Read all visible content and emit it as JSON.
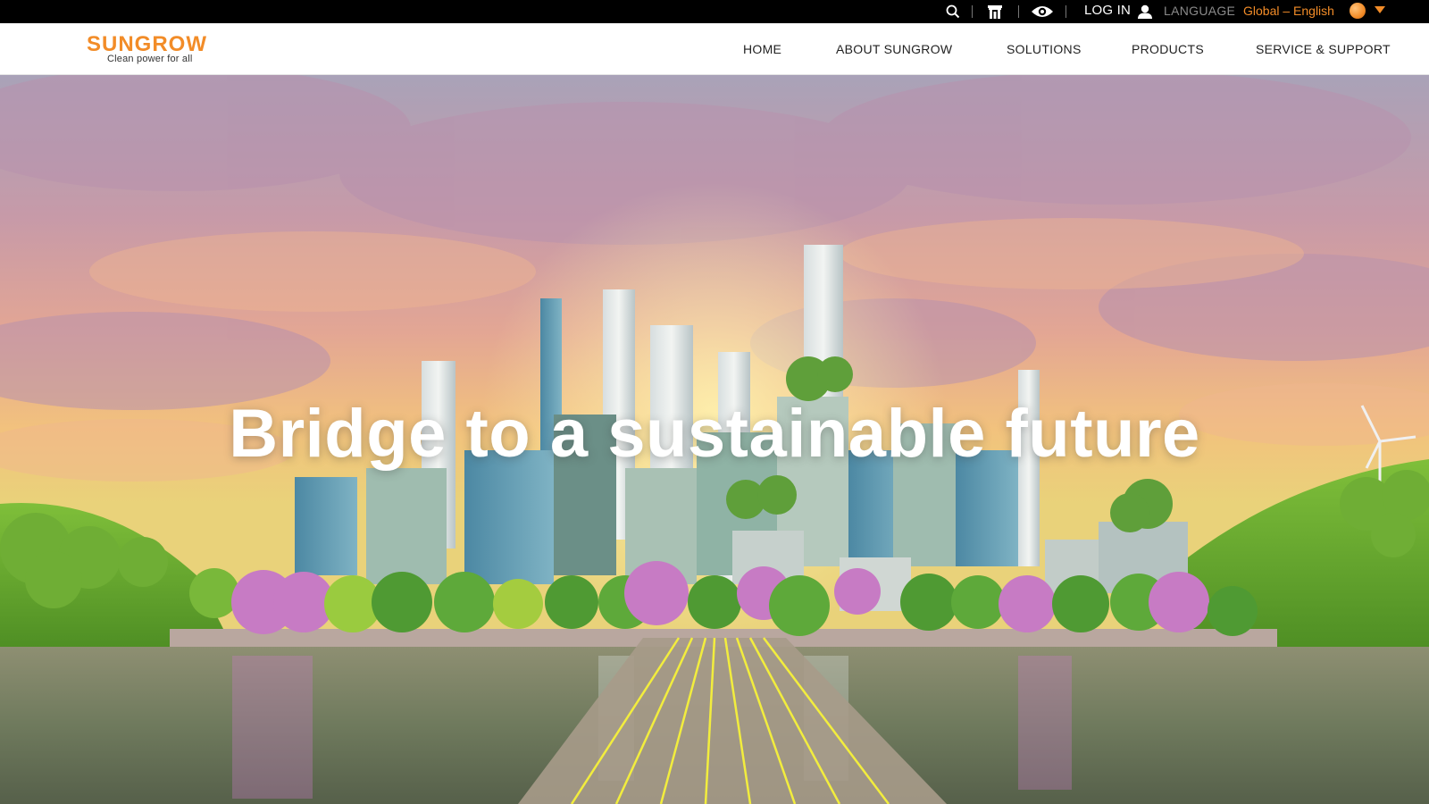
{
  "topbar": {
    "icons": [
      "search-icon",
      "store-icon",
      "eye-icon",
      "user-icon",
      "globe-icon",
      "caret-down-icon"
    ],
    "login_label": "LOG IN",
    "language_label": "LANGUAGE",
    "language_value": "Global – English"
  },
  "brand": {
    "name": "SUNGROW",
    "tagline": "Clean power for all",
    "color": "#f28c28"
  },
  "nav": {
    "items": [
      "HOME",
      "ABOUT SUNGROW",
      "SOLUTIONS",
      "PRODUCTS",
      "SERVICE & SUPPORT"
    ]
  },
  "hero": {
    "title": "Bridge to a sustainable future"
  },
  "colors": {
    "accent": "#f28c28",
    "topbar_bg": "#000000",
    "header_bg": "#ffffff",
    "nav_text": "#222222"
  }
}
